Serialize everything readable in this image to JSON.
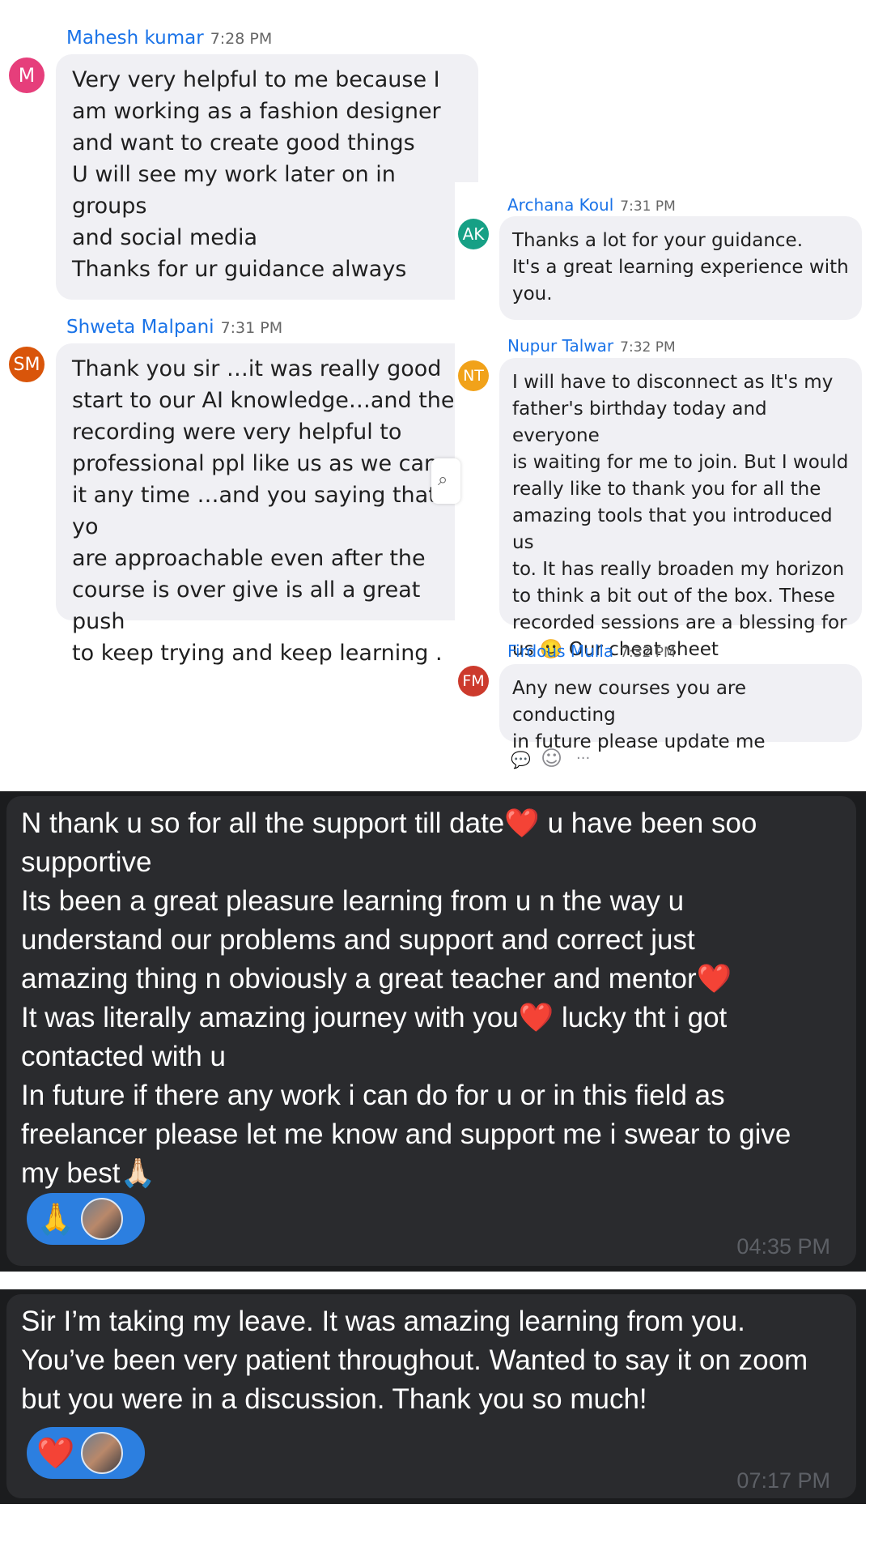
{
  "messages": [
    {
      "initials": "M",
      "avatar_color": "#e63e7b",
      "name": "Mahesh kumar",
      "time": "7:28 PM",
      "text": "Very very helpful to me  because  I\nam working  as a fashion designer\nand  want to create good things\nU will see my work later on in groups\nand social media\nThanks for ur guidance always"
    },
    {
      "initials": "SM",
      "avatar_color": "#d9550a",
      "name": "Shweta Malpani",
      "time": "7:31 PM",
      "text": "Thank you sir …it was really good\nstart to our AI knowledge…and the\nrecording were very helpful to\nprofessional ppl like us as we can s\nit any time …and you saying that yo\nare approachable even after the\ncourse is over give is all a great push\nto keep trying and keep learning ."
    },
    {
      "initials": "AK",
      "avatar_color": "#16a085",
      "name": "Archana Koul",
      "time": "7:31 PM",
      "text": "Thanks a lot for your guidance.\nIt's a great learning experience with\nyou."
    },
    {
      "initials": "NT",
      "avatar_color": "#f1a21a",
      "name": "Nupur Talwar",
      "time": "7:32 PM",
      "text": "I will have to disconnect as It's my\nfather's birthday today and everyone\nis waiting for me to join. But I would\nreally like to thank you for all the\namazing tools that you introduced us\nto. It has really broaden my horizon\nto think a bit out of the box. These\nrecorded sessions are a blessing for\nus 🙂 Our cheat sheet"
    },
    {
      "initials": "FM",
      "avatar_color": "#cc3a2c",
      "name": "Firdous Mulla",
      "time": "7:32 PM",
      "text": "Any new courses you are conducting\nin future please update me"
    }
  ],
  "toolbar_icons": [
    "reply-thread-icon",
    "add-reaction-icon",
    "more-options-icon"
  ],
  "toolbar_glyphs": [
    "💬",
    "☺",
    "···"
  ],
  "dark_messages": [
    {
      "text": "N thank u so for all the support till date❤️ u have been soo\nsupportive\nIts been a great pleasure learning from u n the way u\nunderstand our problems and support and correct just\namazing thing n obviously a great teacher and mentor❤️\nIt was literally amazing journey with you❤️ lucky tht i got\ncontacted with u\nIn future if there any work i can do for u or in this field as\nfreelancer please let me know and support me i swear to give\nmy best🙏🏻",
      "reaction": "🙏",
      "time": "04:35 PM"
    },
    {
      "text": "Sir I’m taking my leave. It was amazing learning from you.\nYou’ve been very patient throughout. Wanted to say it on zoom\nbut you were in a discussion. Thank you so much!",
      "reaction": "❤️",
      "time": "07:17 PM"
    }
  ]
}
